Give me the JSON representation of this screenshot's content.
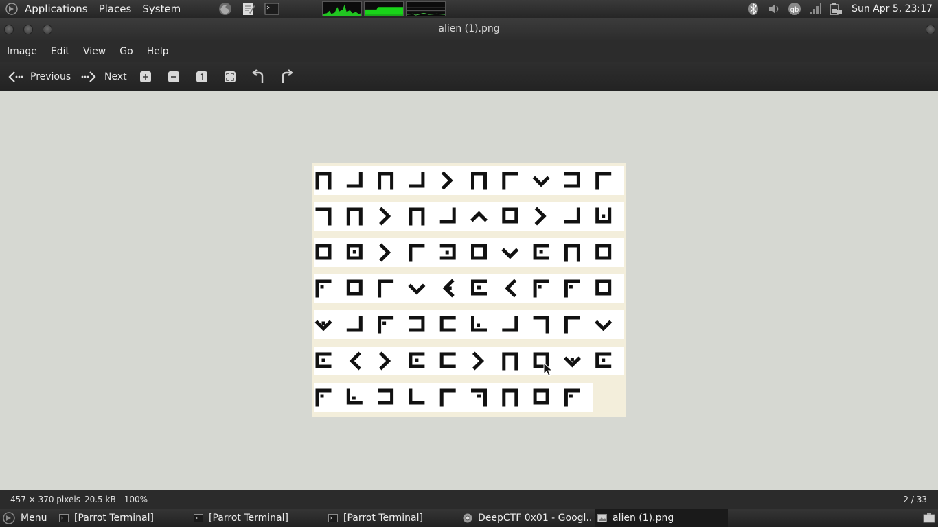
{
  "top_panel": {
    "menus": [
      "Applications",
      "Places",
      "System"
    ],
    "clock": "Sun Apr  5, 23:17"
  },
  "window": {
    "title": "alien (1).png"
  },
  "menubar": [
    "Image",
    "Edit",
    "View",
    "Go",
    "Help"
  ],
  "toolbar": {
    "previous_label": "Previous",
    "next_label": "Next",
    "icons": [
      "zoom-in-icon",
      "zoom-out-icon",
      "normal-size-icon",
      "best-fit-icon",
      "rotate-left-icon",
      "rotate-right-icon"
    ]
  },
  "image": {
    "glyph_rows": [
      [
        "n",
        "rc",
        "n",
        "rc",
        "gt",
        "n",
        "lt",
        "v",
        "e3",
        "lt"
      ],
      [
        "rt",
        "n",
        "gt",
        "n",
        "rc",
        "hat",
        "sq",
        "gt",
        "rc",
        "udot"
      ],
      [
        "sq",
        "sqdot",
        "gt",
        "lt",
        "e3dot",
        "sq",
        "v",
        "cdot",
        "n",
        "sq"
      ],
      [
        "ltdot",
        "sq",
        "lt",
        "v",
        "lessdot",
        "cdot",
        "less",
        "ltdot",
        "ltdot",
        "sq"
      ],
      [
        "vdot",
        "rc",
        "ltdot",
        "e3",
        "c",
        "lbdot",
        "rc",
        "rt",
        "lt",
        "v"
      ],
      [
        "cdot",
        "less",
        "gt",
        "cdot",
        "c",
        "gt",
        "n",
        "sq",
        "vdot",
        "cdot"
      ],
      [
        "ltdot",
        "lbdot",
        "e3",
        "lb",
        "lt",
        "rtdot",
        "n",
        "sq",
        "ltdot"
      ]
    ]
  },
  "status": {
    "dimensions": "457 × 370 pixels",
    "filesize": "20.5 kB",
    "zoom": "100%",
    "index": "2 / 33"
  },
  "taskbar": {
    "menu_label": "Menu",
    "tasks": [
      "[Parrot Terminal]",
      "[Parrot Terminal]",
      "[Parrot Terminal]",
      "DeepCTF 0x01 - Googl...",
      "alien (1).png"
    ]
  }
}
